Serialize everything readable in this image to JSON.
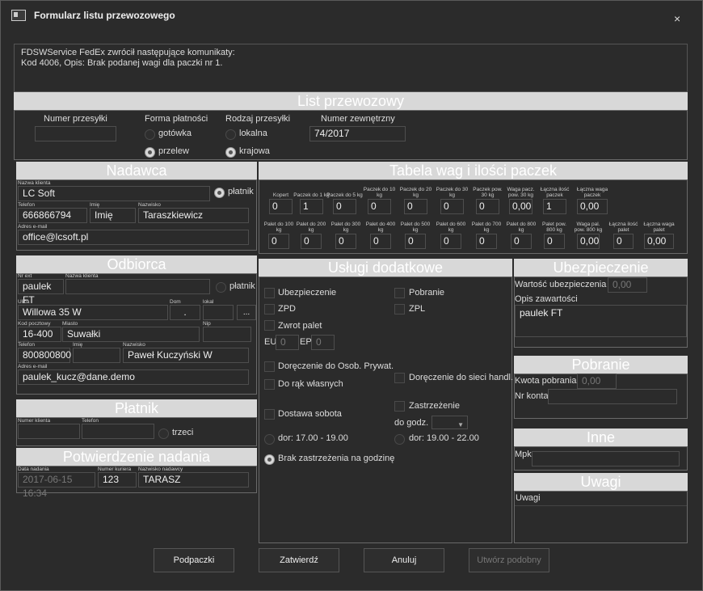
{
  "window": {
    "title": "Formularz listu przewozowego",
    "close": "×"
  },
  "message": "FDSWService FedEx zwrócił następujące komunikaty:\nKod 4006, Opis: Brak podanej wagi dla paczki nr 1.",
  "list": {
    "header": "List przewozowy",
    "numer_label": "Numer przesyłki",
    "numer_value": "",
    "forma_label": "Forma płatności",
    "gotowka": "gotówka",
    "przelew": "przelew",
    "rodzaj_label": "Rodzaj przesyłki",
    "lokalna": "lokalna",
    "krajowa": "krajowa",
    "zewn_label": "Numer zewnętrzny",
    "zewn_value": "74/2017"
  },
  "nadawca": {
    "header": "Nadawca",
    "nazwa_label": "Nazwa klienta",
    "nazwa": "LC Soft",
    "platnik": "płatnik",
    "tel_label": "Telefon",
    "tel": "666866794",
    "imie_label": "Imię",
    "imie": "Imię",
    "nazwisko_label": "Nazwisko",
    "nazwisko": "Taraszkiewicz",
    "email_label": "Adres e-mail",
    "email": "office@lcsoft.pl"
  },
  "odbiorca": {
    "header": "Odbiorca",
    "nrext_label": "Nr ext",
    "nrext": "paulek FT",
    "nazwa_label": "Nazwa klienta",
    "nazwa": "",
    "platnik": "płatnik",
    "ulica_label": "Ulica",
    "ulica": "Willowa 35 W",
    "dom_label": "Dom",
    "dom": ".",
    "lokal_label": "lokal",
    "lokal": "",
    "more": "...",
    "kod_label": "Kod pocztowy",
    "kod": "16-400",
    "miasto_label": "Miasto",
    "miasto": "Suwałki",
    "nip_label": "Nip",
    "nip": "",
    "tel_label": "Telefon",
    "tel": "800800800",
    "imie_label": "Imię",
    "imie": "",
    "nazwisko_label": "Nazwisko",
    "nazwisko": "Paweł Kuczyński W",
    "email_label": "Adres e-mail",
    "email": "paulek_kucz@dane.demo"
  },
  "platnik": {
    "header": "Płatnik",
    "numer_label": "Numer klienta",
    "tel_label": "Telefon",
    "trzeci": "trzeci"
  },
  "potwierdzenie": {
    "header": "Potwierdzenie nadania",
    "data_label": "Data nadania",
    "data": "2017-06-15 16:34",
    "kurier_label": "Numer kuriera",
    "kurier": "123",
    "nadawca_label": "Nazwisko nadawcy",
    "nadawca": "TARASZ"
  },
  "tabela": {
    "header": "Tabela wag i ilości paczek",
    "row1": [
      {
        "label": "Kopert",
        "value": "0"
      },
      {
        "label": "Paczek do 1 kg",
        "value": "1"
      },
      {
        "label": "Paczek do 5 kg",
        "value": "0"
      },
      {
        "label": "Paczek do 10 kg",
        "value": "0"
      },
      {
        "label": "Paczek do 20 kg",
        "value": "0"
      },
      {
        "label": "Paczek do 30 kg",
        "value": "0"
      },
      {
        "label": "Paczek pow. 30 kg",
        "value": "0"
      },
      {
        "label": "Waga pacz. pow. 30 kg",
        "value": "0,00"
      },
      {
        "label": "Łączna ilość paczek",
        "value": "1"
      },
      {
        "label": "Łączna waga paczek",
        "value": "0,00"
      }
    ],
    "row2": [
      {
        "label": "Palet do 100 kg",
        "value": "0"
      },
      {
        "label": "Palet do 200 kg",
        "value": "0"
      },
      {
        "label": "Palet do 300 kg",
        "value": "0"
      },
      {
        "label": "Palet do 400 kg",
        "value": "0"
      },
      {
        "label": "Palet do 500 kg",
        "value": "0"
      },
      {
        "label": "Palet do 600 kg",
        "value": "0"
      },
      {
        "label": "Palet do 700 kg",
        "value": "0"
      },
      {
        "label": "Palet do 800 kg",
        "value": "0"
      },
      {
        "label": "Palet pow. 800 kg",
        "value": "0"
      },
      {
        "label": "Waga pal. pow. 800 kg",
        "value": "0,00"
      },
      {
        "label": "Łączna ilość palet",
        "value": "0"
      },
      {
        "label": "Łączna waga palet",
        "value": "0,00"
      }
    ]
  },
  "uslugi": {
    "header": "Usługi dodatkowe",
    "ubezpieczenie": "Ubezpieczenie",
    "pobranie": "Pobranie",
    "zpd": "ZPD",
    "zpl": "ZPL",
    "zwrot": "Zwrot palet",
    "eu": "EU",
    "eu_value": "0",
    "ep": "EP",
    "ep_value": "0",
    "dor_osob": "Doręczenie do Osob. Prywat.",
    "dor_rak": "Do rąk własnych",
    "dor_sieci": "Doręczenie do sieci handl.",
    "zastrzezenie": "Zastrzeżenie",
    "do_godz": "do godz.",
    "sobota": "Dostawa sobota",
    "dor1": "dor: 17.00 - 19.00",
    "dor2": "dor: 19.00 - 22.00",
    "brak": "Brak zastrzeżenia na godzinę"
  },
  "ubezp": {
    "header": "Ubezpieczenie",
    "wartosc_label": "Wartość ubezpieczenia",
    "wartosc": "0,00",
    "opis_label": "Opis zawartości",
    "opis": "paulek FT"
  },
  "pobranie": {
    "header": "Pobranie",
    "kwota_label": "Kwota pobrania",
    "kwota": "0,00",
    "konto_label": "Nr konta",
    "konto": ""
  },
  "inne": {
    "header": "Inne",
    "mpk_label": "Mpk",
    "mpk": ""
  },
  "uwagi": {
    "header": "Uwagi",
    "label": "Uwagi"
  },
  "buttons": {
    "podpaczki": "Podpaczki",
    "zatwierdz": "Zatwierdź",
    "anuluj": "Anuluj",
    "utworz": "Utwórz podobny"
  }
}
